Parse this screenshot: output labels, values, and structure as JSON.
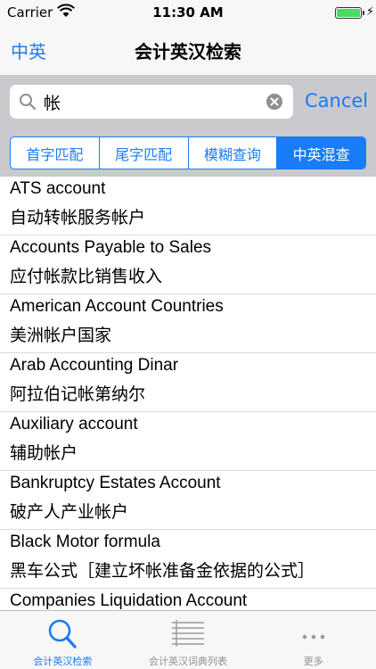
{
  "status_bar": {
    "carrier": "Carrier",
    "time": "11:30 AM"
  },
  "nav": {
    "left_label": "中英",
    "title": "会计英汉检索"
  },
  "search": {
    "value": "帐",
    "cancel_label": "Cancel"
  },
  "segments": [
    {
      "label": "首字匹配",
      "active": false
    },
    {
      "label": "尾字匹配",
      "active": false
    },
    {
      "label": "模糊查询",
      "active": false
    },
    {
      "label": "中英混查",
      "active": true
    }
  ],
  "results": [
    {
      "en": "ATS account",
      "zh": "自动转帐服务帐户"
    },
    {
      "en": "Accounts Payable to Sales",
      "zh": "应付帐款比销售收入"
    },
    {
      "en": "American Account Countries",
      "zh": "美洲帐户国家"
    },
    {
      "en": "Arab Accounting Dinar",
      "zh": "阿拉伯记帐第纳尔"
    },
    {
      "en": "Auxiliary account",
      "zh": "辅助帐户"
    },
    {
      "en": "Bankruptcy Estates Account",
      "zh": "破产人产业帐户"
    },
    {
      "en": "Black Motor formula",
      "zh": "黑车公式［建立坏帐准备金依据的公式］"
    },
    {
      "en": "Companies Liquidation Account",
      "zh": ""
    }
  ],
  "tabs": [
    {
      "label": "会计英汉检索",
      "icon": "search-icon",
      "active": true
    },
    {
      "label": "会计英汉词典列表",
      "icon": "list-icon",
      "active": false
    },
    {
      "label": "更多",
      "icon": "more-icon",
      "active": false
    }
  ],
  "colors": {
    "accent": "#1a7cf6",
    "bar_bg": "#f7f7f7",
    "search_bg": "#c9c9ce",
    "battery": "#4cd964"
  }
}
